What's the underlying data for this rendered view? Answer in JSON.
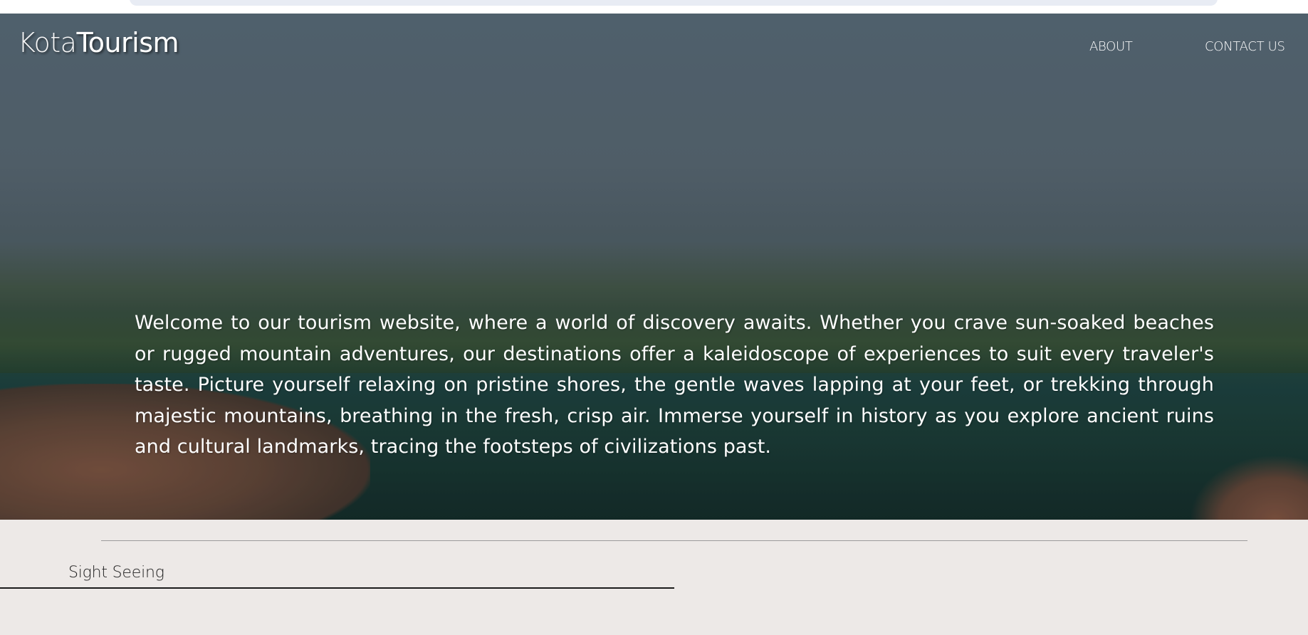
{
  "logo": {
    "part1": "Kota",
    "part2": "Tourism"
  },
  "nav": {
    "about": "ABOUT",
    "contact": "CONTACT US"
  },
  "hero": {
    "text": "Welcome to our tourism website, where a world of discovery awaits. Whether you crave sun-soaked beaches or rugged mountain adventures, our destinations offer a kaleidoscope of experiences to suit every traveler's taste. Picture yourself relaxing on pristine shores, the gentle waves lapping at your feet, or trekking through majestic mountains, breathing in the fresh, crisp air. Immerse yourself in history as you explore ancient ruins and cultural landmarks, tracing the footsteps of civilizations past."
  },
  "section": {
    "title": "Sight Seeing"
  },
  "colors": {
    "page_background": "#ede9e7",
    "text_light": "#ffffff",
    "text_dark": "#222222"
  }
}
